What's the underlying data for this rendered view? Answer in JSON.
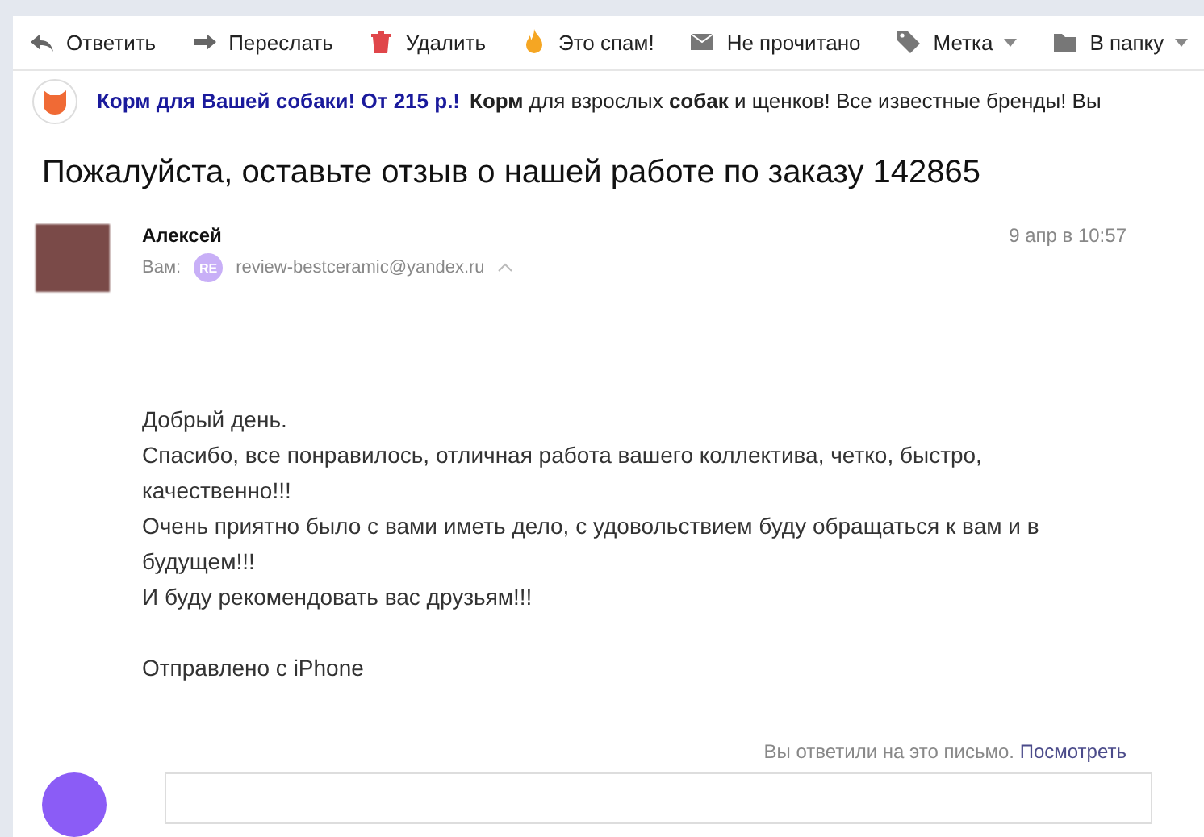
{
  "toolbar": [
    {
      "kind": "reply",
      "label": "Ответить",
      "caret": false
    },
    {
      "kind": "forward",
      "label": "Переслать",
      "caret": false
    },
    {
      "kind": "delete",
      "label": "Удалить",
      "caret": false
    },
    {
      "kind": "spam",
      "label": "Это спам!",
      "caret": false
    },
    {
      "kind": "unread",
      "label": "Не прочитано",
      "caret": false
    },
    {
      "kind": "label",
      "label": "Метка",
      "caret": true
    },
    {
      "kind": "folder",
      "label": "В папку",
      "caret": true
    }
  ],
  "ad": {
    "link": "Корм для Вашей собаки! От 215 р.!",
    "text": "**Корм** для взрослых **собак** и щенков! Все известные бренды! Вы"
  },
  "message": {
    "subject": "Пожалуйста, оставьте отзыв о нашей работе по заказу 142865",
    "sender": "Алексей",
    "to_label": "Вам:",
    "to_badge": "RE",
    "to_address": "review-bestceramic@yandex.ru",
    "date": "9 апр в 10:57",
    "body": [
      [
        "Добрый день.",
        "Спасибо, все понравилось, отличная работа вашего коллектива, четко, быстро, качественно!!!",
        "Очень приятно было с вами иметь дело, с удовольствием буду обращаться к вам и в будущем!!!",
        "И буду рекомендовать вас друзьям!!!"
      ],
      [
        "Отправлено с iPhone"
      ]
    ]
  },
  "reply_notice": {
    "text": "Вы ответили на это письмо.",
    "link": "Посмотреть"
  }
}
